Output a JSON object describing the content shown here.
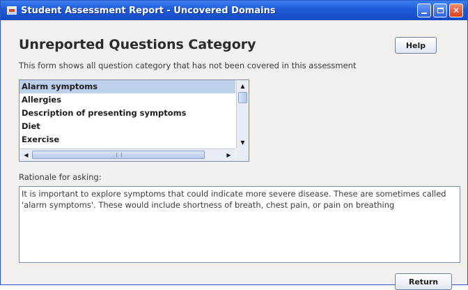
{
  "window": {
    "title": "Student Assessment Report - Uncovered Domains",
    "controls": {
      "minimize_icon": "minimize-icon",
      "maximize_icon": "maximize-icon",
      "close_glyph": "✕"
    }
  },
  "header": {
    "title": "Unreported Questions Category",
    "help_label": "Help"
  },
  "description": "This form shows all question category that has not been covered in this assessment",
  "category_list": {
    "selected_index": 0,
    "items": [
      "Alarm symptoms",
      "Allergies",
      "Description of presenting symptoms",
      "Diet",
      "Exercise"
    ]
  },
  "rationale": {
    "label": "Rationale for asking:",
    "text": "It is important to explore symptoms that could indicate more severe disease. These are sometimes called 'alarm symptoms'. These would include shortness of breath, chest pain, or pain on breathing"
  },
  "footer": {
    "return_label": "Return"
  },
  "colors": {
    "titlebar": "#1e5ad8",
    "selection": "#bcd0ec",
    "window_bg": "#f1f0ec"
  }
}
